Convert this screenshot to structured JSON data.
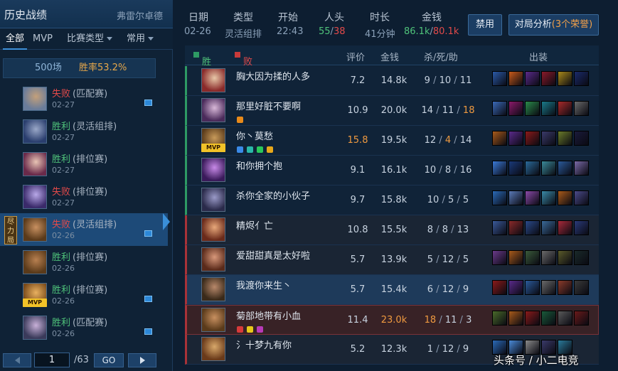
{
  "sidebar": {
    "title": "历史战绩",
    "player": "弗雷尔卓德",
    "filters": {
      "all": "全部",
      "mvp": "MVP",
      "type": "比赛类型",
      "common": "常用"
    },
    "games_count": "500场",
    "win_rate": "胜率53.2%",
    "selected_tag": "尽力局",
    "matches": [
      {
        "result": "失败",
        "type": "(匹配赛)",
        "date": "02-27",
        "win": false,
        "shot": true,
        "mvp": false,
        "colors": [
          "#6a7c9a",
          "#c4a07a"
        ]
      },
      {
        "result": "胜利",
        "type": "(灵活组排)",
        "date": "02-27",
        "win": true,
        "shot": false,
        "mvp": false,
        "colors": [
          "#2a3e6e",
          "#9aa8c8"
        ]
      },
      {
        "result": "胜利",
        "type": "(排位赛)",
        "date": "02-27",
        "win": true,
        "shot": false,
        "mvp": false,
        "colors": [
          "#6a2a4a",
          "#e8c4b4"
        ]
      },
      {
        "result": "失败",
        "type": "(排位赛)",
        "date": "02-27",
        "win": false,
        "shot": false,
        "mvp": false,
        "colors": [
          "#3a2a6a",
          "#b8a8e8"
        ]
      },
      {
        "result": "失败",
        "type": "(灵活组排)",
        "date": "02-26",
        "win": false,
        "shot": true,
        "mvp": false,
        "colors": [
          "#5a3a1a",
          "#c89060"
        ],
        "selected": true
      },
      {
        "result": "胜利",
        "type": "(排位赛)",
        "date": "02-26",
        "win": true,
        "shot": false,
        "mvp": false,
        "colors": [
          "#5a3a1a",
          "#b88050"
        ]
      },
      {
        "result": "胜利",
        "type": "(排位赛)",
        "date": "02-26",
        "win": true,
        "shot": true,
        "mvp": true,
        "mvp_label": "MVP",
        "colors": [
          "#7a4a1a",
          "#e8b060"
        ]
      },
      {
        "result": "胜利",
        "type": "(匹配赛)",
        "date": "02-26",
        "win": true,
        "shot": true,
        "mvp": false,
        "colors": [
          "#3a3a5a",
          "#c8b0d8"
        ]
      }
    ],
    "pager": {
      "page": "1",
      "total": "/63",
      "go": "GO"
    }
  },
  "summary": {
    "date_label": "日期",
    "date": "02-26",
    "type_label": "类型",
    "type": "灵活组排",
    "start_label": "开始",
    "start": "22:43",
    "kills_label": "人头",
    "kills_blue": "55",
    "kills_red": "38",
    "duration_label": "时长",
    "duration": "41分钟",
    "gold_label": "金钱",
    "gold_blue": "86.1k",
    "gold_red": "80.1k",
    "ban_button": "禁用",
    "analysis_button": "对局分析",
    "honors": "(3个荣誉)"
  },
  "table": {
    "blue_team": "胜方",
    "red_team": "败方",
    "score": "评价",
    "gold": "金钱",
    "kda": "杀/死/助",
    "items": "出装",
    "players": [
      {
        "name": "胸大因为揉的人多",
        "score": "7.2",
        "gold": "14.8k",
        "k": "9",
        "d": "10",
        "a": "11",
        "team": "blue",
        "av": [
          "#8a2a2a",
          "#e8c8a8"
        ],
        "items": [
          "#2a5aa8",
          "#c85a1a",
          "#5a2a8a",
          "#8a1a2a",
          "#a8881a",
          "#1a2a6a"
        ]
      },
      {
        "name": "那里好脏不要啊",
        "score": "10.9",
        "gold": "20.0k",
        "k": "14",
        "d": "11",
        "a": "18",
        "team": "blue",
        "a_hl": true,
        "icons": [
          "#e88a1a"
        ],
        "av": [
          "#4a2a5a",
          "#d8b8d8"
        ],
        "items": [
          "#3a6ab8",
          "#8a1a6a",
          "#2a8a4a",
          "#1a7a8a",
          "#a82a2a",
          "#6a6a6a"
        ]
      },
      {
        "name": "你丶莫愁",
        "score": "15.8",
        "gold": "19.5k",
        "k": "12",
        "d": "4",
        "a": "14",
        "team": "blue",
        "score_hl": true,
        "d_hl": true,
        "mvp": true,
        "mvp_label": "MVP",
        "icons": [
          "#3a8ae8",
          "#2ab8a8",
          "#2ac85a",
          "#e8a81a"
        ],
        "av": [
          "#5a3a1a",
          "#c89a5a"
        ],
        "items": [
          "#a85a1a",
          "#5a2a8a",
          "#8a1a1a",
          "#3a3a6a",
          "#6a7a2a",
          "#1a1a3a"
        ]
      },
      {
        "name": "和你拥个抱",
        "score": "9.1",
        "gold": "16.1k",
        "k": "10",
        "d": "8",
        "a": "16",
        "team": "blue",
        "av": [
          "#3a1a5a",
          "#c88ae8"
        ],
        "items": [
          "#3a7ad8",
          "#1a3a7a",
          "#2a6a9a",
          "#3a8a9a",
          "#2a5a9a",
          "#7a6aa8"
        ]
      },
      {
        "name": "杀你全家的小伙子",
        "score": "9.7",
        "gold": "15.8k",
        "k": "10",
        "d": "5",
        "a": "5",
        "team": "blue",
        "av": [
          "#2a2a4a",
          "#9a9ac8"
        ],
        "items": [
          "#2a6ab8",
          "#5a7ab8",
          "#8a4aa8",
          "#3a8aa8",
          "#a85a1a",
          "#4a4a8a"
        ]
      },
      {
        "name": "精烬亻亡",
        "score": "10.8",
        "gold": "15.5k",
        "k": "8",
        "d": "8",
        "a": "13",
        "team": "red",
        "av": [
          "#6a2a1a",
          "#e8a87a"
        ],
        "items": [
          "#3a5a9a",
          "#8a2a2a",
          "#2a4a8a",
          "#3a6a9a",
          "#a82a3a",
          "#2a3a7a"
        ]
      },
      {
        "name": "爱甜甜真是太好啦",
        "score": "5.7",
        "gold": "13.9k",
        "k": "5",
        "d": "12",
        "a": "5",
        "team": "red",
        "av": [
          "#5a2a1a",
          "#d8987a"
        ],
        "items": [
          "#6a3a8a",
          "#a85a1a",
          "#3a5a3a",
          "#6a6a6a",
          "#5a5a2a",
          "#1a2a2a"
        ]
      },
      {
        "name": "我渡你来生丶",
        "score": "5.7",
        "gold": "15.4k",
        "k": "6",
        "d": "12",
        "a": "9",
        "team": "red",
        "me": true,
        "av": [
          "#3a2a1a",
          "#b8886a"
        ],
        "items": [
          "#8a1a1a",
          "#5a2a8a",
          "#2a5a9a",
          "#6a6a6a",
          "#8a3a2a",
          "#3a3a3a"
        ]
      },
      {
        "name": "菊部地带有小血",
        "score": "11.4",
        "gold": "23.0k",
        "k": "18",
        "d": "11",
        "a": "3",
        "team": "red",
        "hl": true,
        "gold_hl": true,
        "k_hl": true,
        "icons": [
          "#d83a3a",
          "#e8c81a",
          "#b83ab8"
        ],
        "av": [
          "#5a3a1a",
          "#c89060"
        ],
        "items": [
          "#4a6a2a",
          "#a85a1a",
          "#8a1a1a",
          "#1a5a3a",
          "#5a5a5a",
          "#6a1a1a"
        ]
      },
      {
        "name": "氵十梦九有你",
        "score": "5.2",
        "gold": "12.3k",
        "k": "1",
        "d": "12",
        "a": "9",
        "team": "red",
        "av": [
          "#6a3a1a",
          "#d8a86a"
        ],
        "items": [
          "#2a6ab8",
          "#4a8ad8",
          "#8a8a8a",
          "#3a3a6a",
          "#2a7a9a"
        ]
      }
    ]
  },
  "watermark": "头条号 / 小二电竞",
  "colors": {
    "win": "#4fc37a",
    "loss": "#e34a4a",
    "accent": "#f09a40",
    "blue_team": "#2e9a64",
    "red_team": "#a83238"
  }
}
